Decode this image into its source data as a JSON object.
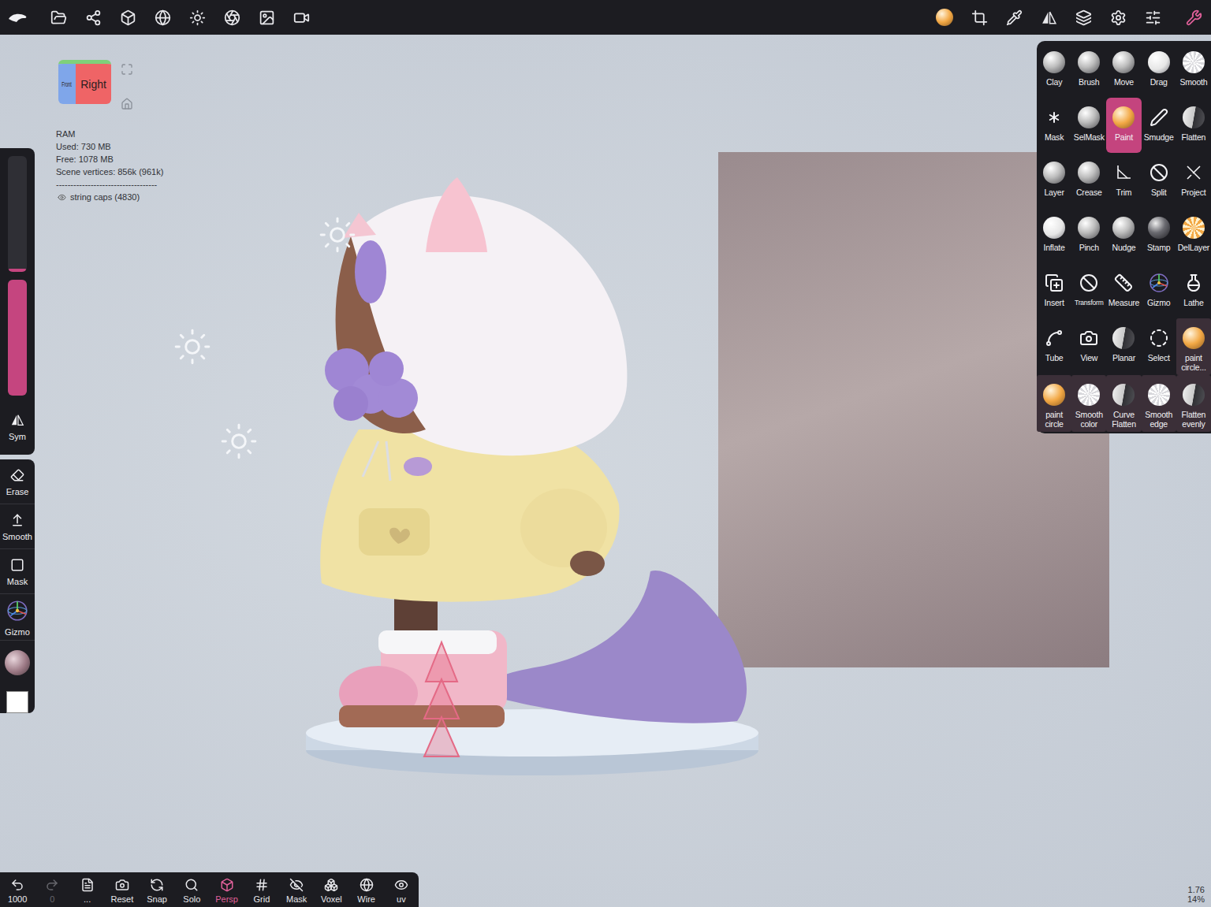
{
  "top_bar": {
    "tools_menu_open": true
  },
  "view_cube": {
    "faces": [
      "Front",
      "Right"
    ]
  },
  "stats": {
    "title": "RAM",
    "lines": [
      "Used: 730 MB",
      "Free: 1078 MB",
      "Scene vertices: 856k (961k)"
    ],
    "separator": "-----------------------------------",
    "objects": [
      {
        "name": "string caps (4830)",
        "visible": true
      }
    ]
  },
  "side_panel": {
    "sliders": [
      {
        "level": 0.03
      },
      {
        "level": 1.0
      }
    ],
    "symmetry": {
      "label": "Sym",
      "on": false
    },
    "tools": [
      {
        "label": "Erase"
      },
      {
        "label": "Smooth"
      },
      {
        "label": "Mask"
      },
      {
        "label": "Gizmo"
      }
    ],
    "swatches": [
      {
        "color": "#9b7884"
      },
      {
        "color": "#ffffff"
      }
    ]
  },
  "tool_grid": [
    {
      "label": "Clay",
      "selected": false,
      "kind": "brush"
    },
    {
      "label": "Brush",
      "selected": false,
      "kind": "brush"
    },
    {
      "label": "Move",
      "selected": false,
      "kind": "brush"
    },
    {
      "label": "Drag",
      "selected": false,
      "kind": "brush"
    },
    {
      "label": "Smooth",
      "selected": false,
      "kind": "brush"
    },
    {
      "label": "Mask",
      "selected": false,
      "kind": "brush"
    },
    {
      "label": "SelMask",
      "selected": false,
      "kind": "brush"
    },
    {
      "label": "Paint",
      "selected": true,
      "kind": "brush"
    },
    {
      "label": "Smudge",
      "selected": false,
      "kind": "brush"
    },
    {
      "label": "Flatten",
      "selected": false,
      "kind": "brush"
    },
    {
      "label": "Layer",
      "selected": false,
      "kind": "brush"
    },
    {
      "label": "Crease",
      "selected": false,
      "kind": "brush"
    },
    {
      "label": "Trim",
      "selected": false,
      "kind": "brush"
    },
    {
      "label": "Split",
      "selected": false,
      "kind": "brush"
    },
    {
      "label": "Project",
      "selected": false,
      "kind": "brush"
    },
    {
      "label": "Inflate",
      "selected": false,
      "kind": "brush"
    },
    {
      "label": "Pinch",
      "selected": false,
      "kind": "brush"
    },
    {
      "label": "Nudge",
      "selected": false,
      "kind": "brush"
    },
    {
      "label": "Stamp",
      "selected": false,
      "kind": "brush"
    },
    {
      "label": "DelLayer",
      "selected": false,
      "kind": "brush"
    },
    {
      "label": "Insert",
      "selected": false,
      "kind": "brush"
    },
    {
      "label": "Transform",
      "selected": false,
      "kind": "brush"
    },
    {
      "label": "Measure",
      "selected": false,
      "kind": "brush"
    },
    {
      "label": "Gizmo",
      "selected": false,
      "kind": "brush"
    },
    {
      "label": "Lathe",
      "selected": false,
      "kind": "brush"
    },
    {
      "label": "Tube",
      "selected": false,
      "kind": "brush"
    },
    {
      "label": "View",
      "selected": false,
      "kind": "brush"
    },
    {
      "label": "Planar",
      "selected": false,
      "kind": "brush"
    },
    {
      "label": "Select",
      "selected": false,
      "kind": "brush"
    },
    {
      "label": "paint circle...",
      "selected": false,
      "kind": "custom"
    },
    {
      "label": "paint circle",
      "selected": false,
      "kind": "custom"
    },
    {
      "label": "Smooth color",
      "selected": false,
      "kind": "custom"
    },
    {
      "label": "Curve Flatten",
      "selected": false,
      "kind": "custom"
    },
    {
      "label": "Smooth edge",
      "selected": false,
      "kind": "custom"
    },
    {
      "label": "Flatten evenly",
      "selected": false,
      "kind": "custom"
    }
  ],
  "bottom_bar": [
    {
      "label": "1000",
      "selected": false,
      "disabled": false
    },
    {
      "label": "0",
      "selected": false,
      "disabled": true
    },
    {
      "label": "...",
      "selected": false,
      "disabled": false
    },
    {
      "label": "Reset",
      "selected": false,
      "disabled": false
    },
    {
      "label": "Snap",
      "selected": false,
      "disabled": false
    },
    {
      "label": "Solo",
      "selected": false,
      "disabled": false
    },
    {
      "label": "Persp",
      "selected": true,
      "disabled": false
    },
    {
      "label": "Grid",
      "selected": false,
      "disabled": false
    },
    {
      "label": "Mask",
      "selected": false,
      "disabled": false
    },
    {
      "label": "Voxel",
      "selected": false,
      "disabled": false
    },
    {
      "label": "Wire",
      "selected": false,
      "disabled": false
    },
    {
      "label": "uv",
      "selected": false,
      "disabled": false
    }
  ],
  "viewport_info": [
    "1.76",
    "14%"
  ]
}
